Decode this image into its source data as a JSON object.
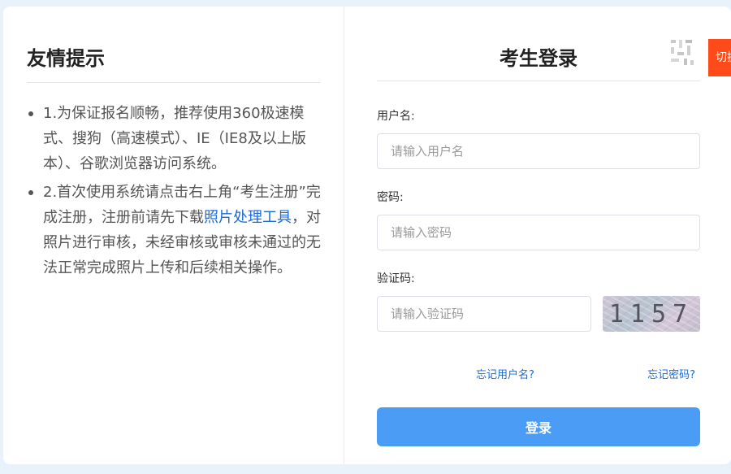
{
  "tips": {
    "title": "友情提示",
    "item1": "1.为保证报名顺畅，推荐使用360极速模式、搜狗（高速模式）、IE（IE8及以上版本）、谷歌浏览器访问系统。",
    "item2_before": "2.首次使用系统请点击右上角“考生注册”完成注册，注册前请先下载",
    "item2_link": "照片处理工具",
    "item2_after": "，对照片进行审核，未经审核或审核未通过的无法正常完成照片上传和后续相关操作。"
  },
  "login": {
    "title": "考生登录",
    "switch_label": "切换",
    "username_label": "用户名:",
    "username_placeholder": "请输入用户名",
    "password_label": "密码:",
    "password_placeholder": "请输入密码",
    "captcha_label": "验证码:",
    "captcha_placeholder": "请输入验证码",
    "captcha_text": "1157",
    "forgot_username": "忘记用户名?",
    "forgot_password": "忘记密码?",
    "submit_label": "登录"
  },
  "colors": {
    "accent": "#4a9cf5",
    "link": "#1b6ad6",
    "switch_tab": "#ff4a1a"
  }
}
